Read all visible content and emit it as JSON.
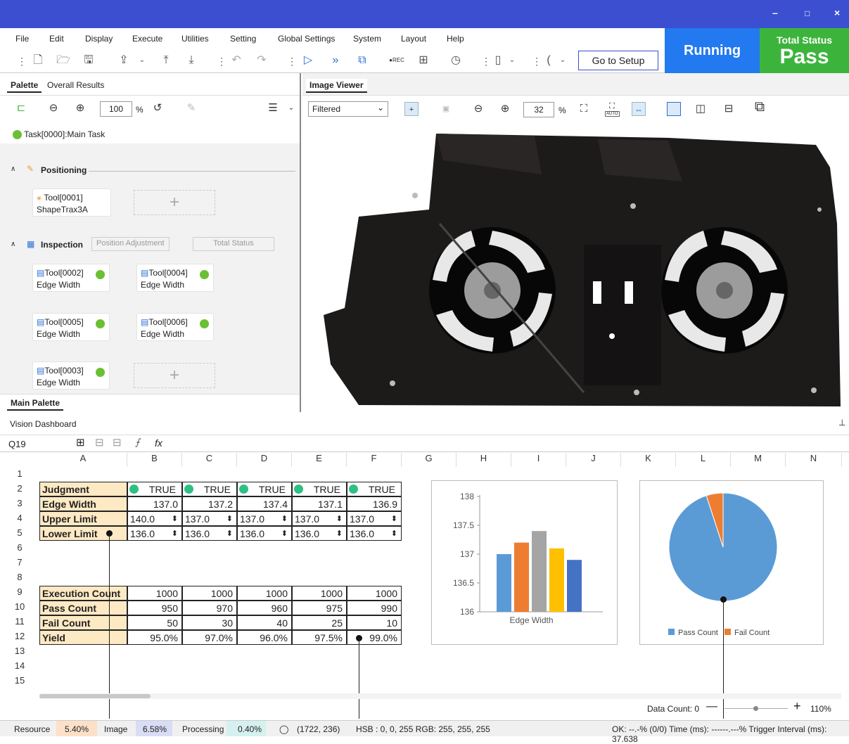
{
  "window": {
    "minimize": "–",
    "maximize": "□",
    "close": "×"
  },
  "menu": [
    "File",
    "Edit",
    "Display",
    "Execute",
    "Utilities",
    "Setting",
    "Global Settings",
    "System",
    "Layout",
    "Help"
  ],
  "toolbar": {
    "go_to_setup": "Go to Setup",
    "rec_label": "●REC"
  },
  "run_state": "Running",
  "total_status": {
    "title": "Total Status",
    "value": "Pass"
  },
  "palette": {
    "tabs": [
      "Palette",
      "Overall Results"
    ],
    "zoom": "100",
    "zoom_unit": "%",
    "task": "Task[0000]:Main Task",
    "sections": {
      "positioning": "Positioning",
      "inspection": "Inspection",
      "position_adjustment": "Position Adjustment",
      "total_status": "Total Status"
    },
    "tools": [
      {
        "id": "Tool[0001]",
        "type": "ShapeTrax3A"
      },
      {
        "id": "Tool[0002]",
        "type": "Edge Width"
      },
      {
        "id": "Tool[0004]",
        "type": "Edge Width"
      },
      {
        "id": "Tool[0005]",
        "type": "Edge Width"
      },
      {
        "id": "Tool[0006]",
        "type": "Edge Width"
      },
      {
        "id": "Tool[0003]",
        "type": "Edge Width"
      }
    ],
    "bottom_tab": "Main Palette"
  },
  "image_viewer": {
    "tab": "Image Viewer",
    "filter": "Filtered",
    "zoom": "32",
    "zoom_unit": "%",
    "auto_label": "AUTO"
  },
  "dashboard": {
    "title": "Vision Dashboard",
    "cell_ref": "Q19",
    "fx": "fx",
    "columns": [
      "A",
      "B",
      "C",
      "D",
      "E",
      "F",
      "G",
      "H",
      "I",
      "J",
      "K",
      "L",
      "M",
      "N"
    ],
    "rows": [
      "1",
      "2",
      "3",
      "4",
      "5",
      "6",
      "7",
      "8",
      "9",
      "10",
      "11",
      "12",
      "13",
      "14",
      "15"
    ],
    "labels": {
      "judgment": "Judgment",
      "edge_width": "Edge Width",
      "upper_limit": "Upper Limit",
      "lower_limit": "Lower Limit",
      "execution_count": "Execution Count",
      "pass_count": "Pass Count",
      "fail_count": "Fail Count",
      "yield": "Yield"
    },
    "judgment": [
      "TRUE",
      "TRUE",
      "TRUE",
      "TRUE",
      "TRUE"
    ],
    "edge_width": [
      "137.0",
      "137.2",
      "137.4",
      "137.1",
      "136.9"
    ],
    "upper_limit": [
      "140.0",
      "137.0",
      "137.0",
      "137.0",
      "137.0"
    ],
    "lower_limit": [
      "136.0",
      "136.0",
      "136.0",
      "136.0",
      "136.0"
    ],
    "execution_count": [
      "1000",
      "1000",
      "1000",
      "1000",
      "1000"
    ],
    "pass_count": [
      "950",
      "970",
      "960",
      "975",
      "990"
    ],
    "fail_count": [
      "50",
      "30",
      "40",
      "25",
      "10"
    ],
    "yield": [
      "95.0%",
      "97.0%",
      "96.0%",
      "97.5%",
      "99.0%"
    ],
    "data_count": "Data Count: 0",
    "zoom": "110%"
  },
  "chart_data": [
    {
      "type": "bar",
      "categories": [
        "Edge Width"
      ],
      "values": [
        137.0,
        137.2,
        137.4,
        137.1,
        136.9
      ],
      "colors": [
        "#5b9bd5",
        "#ed7d31",
        "#a5a5a5",
        "#ffc000",
        "#4472c4"
      ],
      "ylim": [
        136,
        138
      ],
      "yticks": [
        "138",
        "137.5",
        "137",
        "136.5",
        "136"
      ],
      "xlabel": "Edge Width"
    },
    {
      "type": "pie",
      "series": [
        {
          "name": "Pass Count",
          "value": 95
        },
        {
          "name": "Fail Count",
          "value": 5
        }
      ],
      "colors": [
        "#5b9bd5",
        "#ed7d31"
      ]
    }
  ],
  "statusbar": {
    "resource_label": "Resource",
    "resource": "5.40%",
    "image_label": "Image",
    "image": "6.58%",
    "processing_label": "Processing",
    "processing": "0.40%",
    "coords": "(1722, 236)",
    "color_info": "HSB : 0, 0, 255 RGB: 255, 255, 255",
    "right": "OK: --.-% (0/0) Time (ms): ------.---% Trigger Interval (ms): 37.638"
  }
}
